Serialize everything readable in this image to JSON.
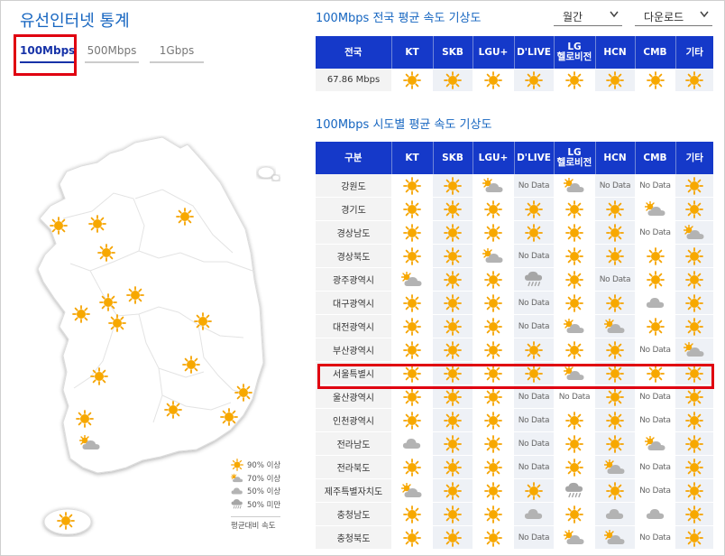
{
  "page_title": "유선인터넷 통계",
  "speed_tabs": [
    "100Mbps",
    "500Mbps",
    "1Gbps"
  ],
  "national": {
    "title": "100Mbps 전국 평균 속도 기상도",
    "period_select": "월간",
    "download_select": "다운로드",
    "columns": [
      "전국",
      "KT",
      "SKB",
      "LGU+",
      "D'LIVE",
      "LG\n헬로비전",
      "HCN",
      "CMB",
      "기타"
    ],
    "row": {
      "avg": "67.86 Mbps",
      "cells": [
        "sun",
        "sun",
        "sun",
        "sun",
        "sun",
        "sun",
        "sun",
        "sun"
      ]
    }
  },
  "regional": {
    "title": "100Mbps 시도별 평균 속도 기상도",
    "columns": [
      "구분",
      "KT",
      "SKB",
      "LGU+",
      "D'LIVE",
      "LG\n헬로비전",
      "HCN",
      "CMB",
      "기타"
    ],
    "no_data_label": "No Data",
    "rows": [
      {
        "region": "강원도",
        "cells": [
          "sun",
          "sun",
          "partly",
          "nodata",
          "partly",
          "nodata",
          "nodata",
          "sun"
        ]
      },
      {
        "region": "경기도",
        "cells": [
          "sun",
          "sun",
          "sun",
          "sun",
          "sun",
          "sun",
          "partly",
          "sun"
        ]
      },
      {
        "region": "경상남도",
        "cells": [
          "sun",
          "sun",
          "sun",
          "sun",
          "sun",
          "sun",
          "nodata",
          "partly"
        ]
      },
      {
        "region": "경상북도",
        "cells": [
          "sun",
          "sun",
          "partly",
          "nodata",
          "sun",
          "sun",
          "sun",
          "sun"
        ]
      },
      {
        "region": "광주광역시",
        "cells": [
          "partly",
          "sun",
          "sun",
          "rain",
          "sun",
          "nodata",
          "sun",
          "sun"
        ]
      },
      {
        "region": "대구광역시",
        "cells": [
          "sun",
          "sun",
          "sun",
          "nodata",
          "sun",
          "sun",
          "cloud",
          "sun"
        ]
      },
      {
        "region": "대전광역시",
        "cells": [
          "sun",
          "sun",
          "sun",
          "nodata",
          "partly",
          "partly",
          "sun",
          "sun"
        ]
      },
      {
        "region": "부산광역시",
        "cells": [
          "sun",
          "sun",
          "sun",
          "sun",
          "sun",
          "sun",
          "nodata",
          "partly"
        ]
      },
      {
        "region": "서울특별시",
        "cells": [
          "sun",
          "sun",
          "sun",
          "sun",
          "partly",
          "sun",
          "sun",
          "sun"
        ]
      },
      {
        "region": "울산광역시",
        "cells": [
          "sun",
          "sun",
          "sun",
          "nodata",
          "nodata",
          "sun",
          "nodata",
          "sun"
        ]
      },
      {
        "region": "인천광역시",
        "cells": [
          "sun",
          "sun",
          "sun",
          "nodata",
          "sun",
          "sun",
          "nodata",
          "sun"
        ]
      },
      {
        "region": "전라남도",
        "cells": [
          "cloud",
          "sun",
          "sun",
          "nodata",
          "sun",
          "sun",
          "partly",
          "sun"
        ]
      },
      {
        "region": "전라북도",
        "cells": [
          "sun",
          "sun",
          "sun",
          "nodata",
          "sun",
          "partly",
          "nodata",
          "sun"
        ]
      },
      {
        "region": "제주특별자치도",
        "cells": [
          "partly",
          "sun",
          "sun",
          "sun",
          "rain",
          "sun",
          "nodata",
          "sun"
        ]
      },
      {
        "region": "충청남도",
        "cells": [
          "sun",
          "sun",
          "sun",
          "cloud",
          "sun",
          "cloud",
          "cloud",
          "sun"
        ]
      },
      {
        "region": "충청북도",
        "cells": [
          "sun",
          "sun",
          "sun",
          "nodata",
          "partly",
          "partly",
          "nodata",
          "sun"
        ]
      }
    ]
  },
  "legend": {
    "items": [
      {
        "icon": "sun",
        "label": "90% 이상"
      },
      {
        "icon": "partly",
        "label": "70% 이상"
      },
      {
        "icon": "cloud",
        "label": "50% 이상"
      },
      {
        "icon": "rain",
        "label": "50% 미만"
      }
    ],
    "caption": "평균대비 속도"
  },
  "colors": {
    "header_blue": "#1539c9",
    "sun": "#f5a300",
    "cloud": "#b5b5b5",
    "highlight": "#e00010",
    "title_blue": "#1565c0"
  }
}
